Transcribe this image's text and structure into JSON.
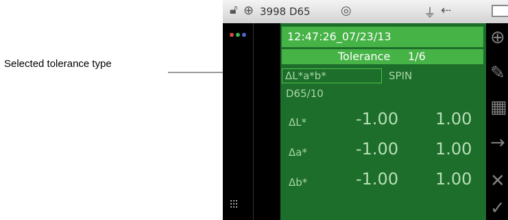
{
  "callout": {
    "text": "Selected tolerance type"
  },
  "status": {
    "illum": "3998 D65"
  },
  "screen": {
    "timestamp": "12:47:26_07/23/13",
    "tolerance_title": "Tolerance",
    "tolerance_page": "1/6",
    "tolerance_type": "ΔL*a*b*",
    "mode": "SPIN",
    "observer": "D65/10",
    "rows": [
      {
        "label": "ΔL*",
        "min": "-1.00",
        "max": "1.00"
      },
      {
        "label": "Δa*",
        "min": "-1.00",
        "max": "1.00"
      },
      {
        "label": "Δb*",
        "min": "-1.00",
        "max": "1.00"
      }
    ]
  },
  "icons": {
    "status": [
      "lock-open-icon",
      "crosshair-icon",
      "target-icon",
      "usb-icon",
      "plug-icon",
      "battery-icon"
    ],
    "left": [
      "color-dots-icon",
      "sliders-icon"
    ],
    "right": [
      "target-icon",
      "pencil-icon",
      "grid-icon",
      "arrow-right-icon",
      "close-icon",
      "check-icon"
    ]
  }
}
